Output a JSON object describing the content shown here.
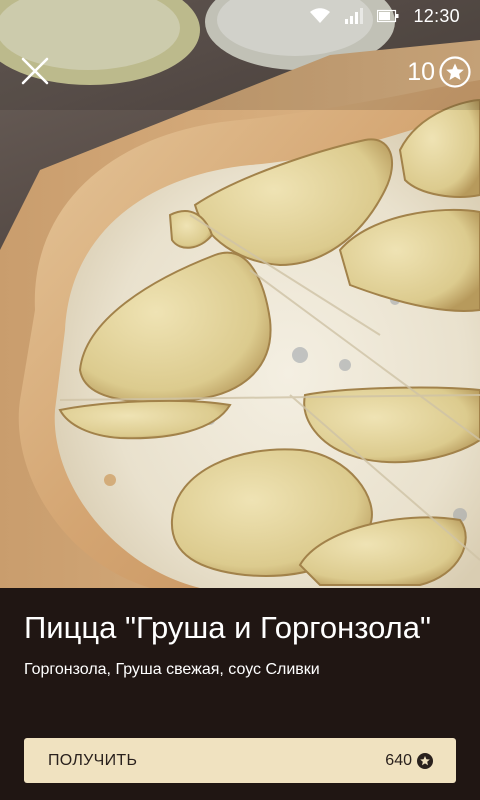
{
  "status_bar": {
    "time": "12:30",
    "icons": [
      "wifi-icon",
      "signal-icon",
      "battery-icon"
    ]
  },
  "header": {
    "close_icon": "close-icon",
    "points_value": "10",
    "points_icon": "star-circle-icon"
  },
  "product": {
    "title": "Пицца \"Груша и Горгонзола\"",
    "ingredients": "Горгонзола, Груша свежая, соус Сливки",
    "action_label": "ПОЛУЧИТЬ",
    "price": "640",
    "price_icon": "star-circle-icon"
  },
  "colors": {
    "panel_background": "#201613",
    "button_background": "#f0e2c0",
    "button_text": "#2a211d",
    "text_primary": "#ffffff"
  }
}
